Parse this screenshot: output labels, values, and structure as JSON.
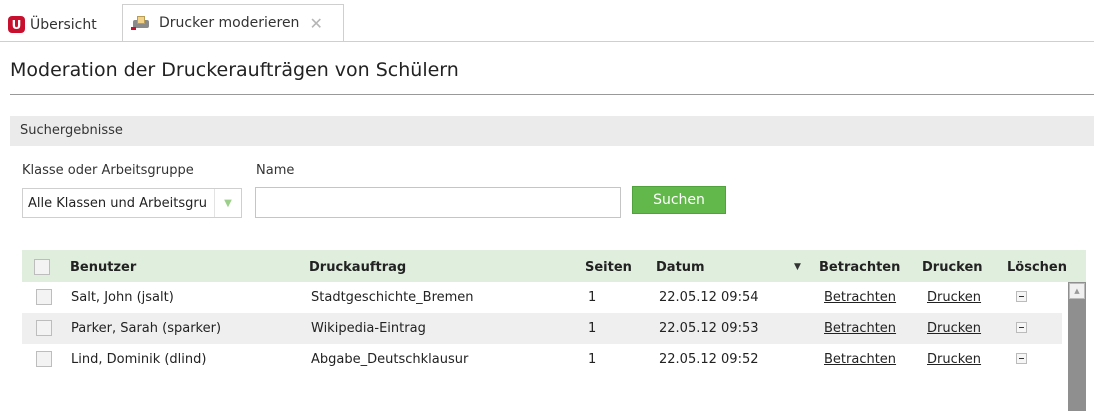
{
  "tabs": [
    {
      "label": "Übersicht",
      "icon": "u-logo-icon"
    },
    {
      "label": "Drucker moderieren",
      "icon": "printer-icon",
      "close": "✕"
    }
  ],
  "page_title": "Moderation der Druckeraufträgen von Schülern",
  "section_title": "Suchergebnisse",
  "filters": {
    "klasse_label": "Klasse oder Arbeitsgruppe",
    "klasse_value": "Alle Klassen und Arbeitsgruppen",
    "name_label": "Name",
    "name_value": "",
    "search_button": "Suchen"
  },
  "table": {
    "headers": {
      "benutzer": "Benutzer",
      "druckauftrag": "Druckauftrag",
      "seiten": "Seiten",
      "datum": "Datum",
      "betrachten": "Betrachten",
      "drucken": "Drucken",
      "loeschen": "Löschen"
    },
    "rows": [
      {
        "benutzer": "Salt, John (jsalt)",
        "druckauftrag": "Stadtgeschichte_Bremen",
        "seiten": "1",
        "datum": "22.05.12 09:54",
        "betrachten": "Betrachten",
        "drucken": "Drucken"
      },
      {
        "benutzer": "Parker, Sarah (sparker)",
        "druckauftrag": "Wikipedia-Eintrag",
        "seiten": "1",
        "datum": "22.05.12 09:53",
        "betrachten": "Betrachten",
        "drucken": "Drucken"
      },
      {
        "benutzer": "Lind, Dominik (dlind)",
        "druckauftrag": "Abgabe_Deutschklausur",
        "seiten": "1",
        "datum": "22.05.12 09:52",
        "betrachten": "Betrachten",
        "drucken": "Drucken"
      }
    ]
  },
  "colors": {
    "brand_red": "#c8102e",
    "accent_green": "#62b84b",
    "header_green": "#dfeedd"
  }
}
